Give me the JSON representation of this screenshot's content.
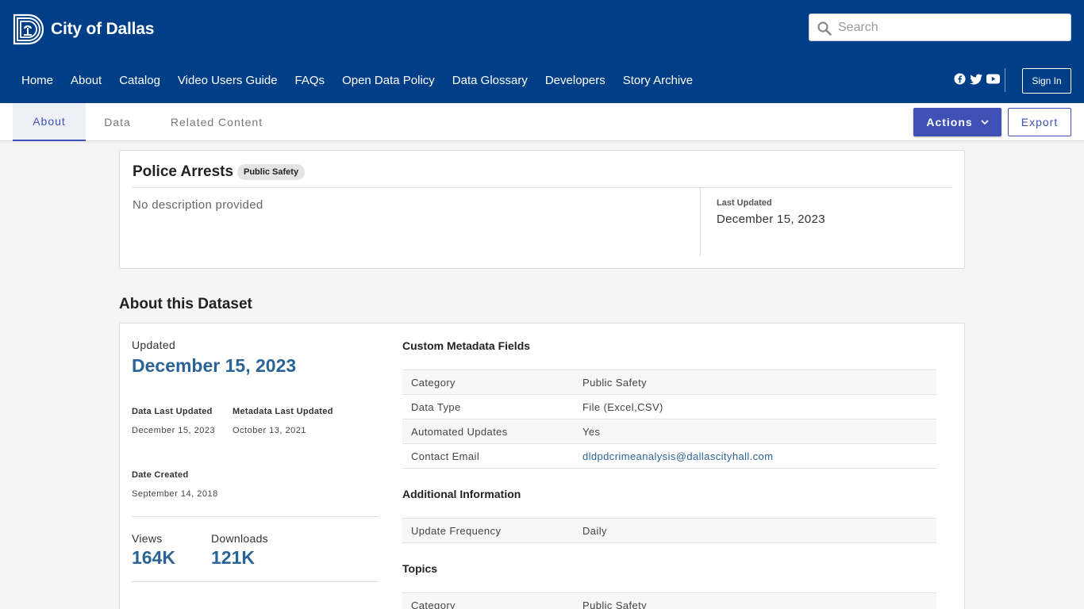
{
  "header": {
    "logo_text": "City of Dallas",
    "search_placeholder": "Search",
    "nav": [
      "Home",
      "About",
      "Catalog",
      "Video Users Guide",
      "FAQs",
      "Open Data Policy",
      "Data Glossary",
      "Developers",
      "Story Archive"
    ],
    "social_icons": [
      "facebook-icon",
      "twitter-icon",
      "youtube-icon"
    ],
    "sign_in": "Sign In",
    "brand_color": "#003f87"
  },
  "tabs": {
    "items": [
      "About",
      "Data",
      "Related Content"
    ],
    "active": "About",
    "actions_label": "Actions",
    "export_label": "Export",
    "accent_color": "#3f51b5"
  },
  "dataset": {
    "title": "Police Arrests",
    "badge": "Public Safety",
    "description": "No description provided",
    "last_updated_label": "Last Updated",
    "last_updated_value": "December 15, 2023"
  },
  "about": {
    "heading": "About this Dataset",
    "updated_label": "Updated",
    "updated_value": "December 15, 2023",
    "data_last_updated_label": "Data Last Updated",
    "data_last_updated_value": "December 15, 2023",
    "metadata_last_updated_label": "Metadata Last Updated",
    "metadata_last_updated_value": "October 13, 2021",
    "date_created_label": "Date Created",
    "date_created_value": "September 14, 2018",
    "views_label": "Views",
    "views_value": "164K",
    "downloads_label": "Downloads",
    "downloads_value": "121K"
  },
  "metadata": {
    "custom_heading": "Custom Metadata Fields",
    "custom_rows": [
      {
        "key": "Category",
        "value": "Public Safety"
      },
      {
        "key": "Data Type",
        "value": "File (Excel,CSV)"
      },
      {
        "key": "Automated Updates",
        "value": "Yes"
      },
      {
        "key": "Contact Email",
        "value": "dldpdcrimeanalysis@dallascityhall.com"
      }
    ],
    "additional_heading": "Additional Information",
    "additional_rows": [
      {
        "key": "Update Frequency",
        "value": "Daily"
      }
    ],
    "topics_heading": "Topics",
    "topics_rows": [
      {
        "key": "Category",
        "value": "Public Safety"
      }
    ]
  }
}
